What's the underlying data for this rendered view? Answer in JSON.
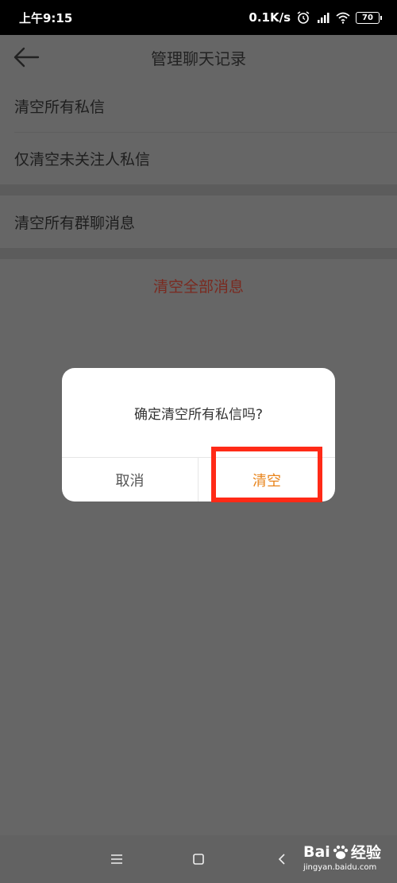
{
  "status_bar": {
    "time": "上午9:15",
    "speed": "0.1K/s",
    "battery": "70"
  },
  "header": {
    "title": "管理聊天记录"
  },
  "list": {
    "clear_all_private": "清空所有私信",
    "clear_unfollowed_private": "仅清空未关注人私信",
    "clear_all_group": "清空所有群聊消息",
    "clear_all_messages": "清空全部消息"
  },
  "dialog": {
    "message": "确定清空所有私信吗?",
    "cancel": "取消",
    "confirm": "清空"
  },
  "watermark": {
    "brand_left": "Bai",
    "brand_right": "经验",
    "url": "jingyan.baidu.com"
  },
  "colors": {
    "accent": "#e8841b",
    "highlight": "#ff2a17",
    "danger_text": "#7a2a20"
  }
}
